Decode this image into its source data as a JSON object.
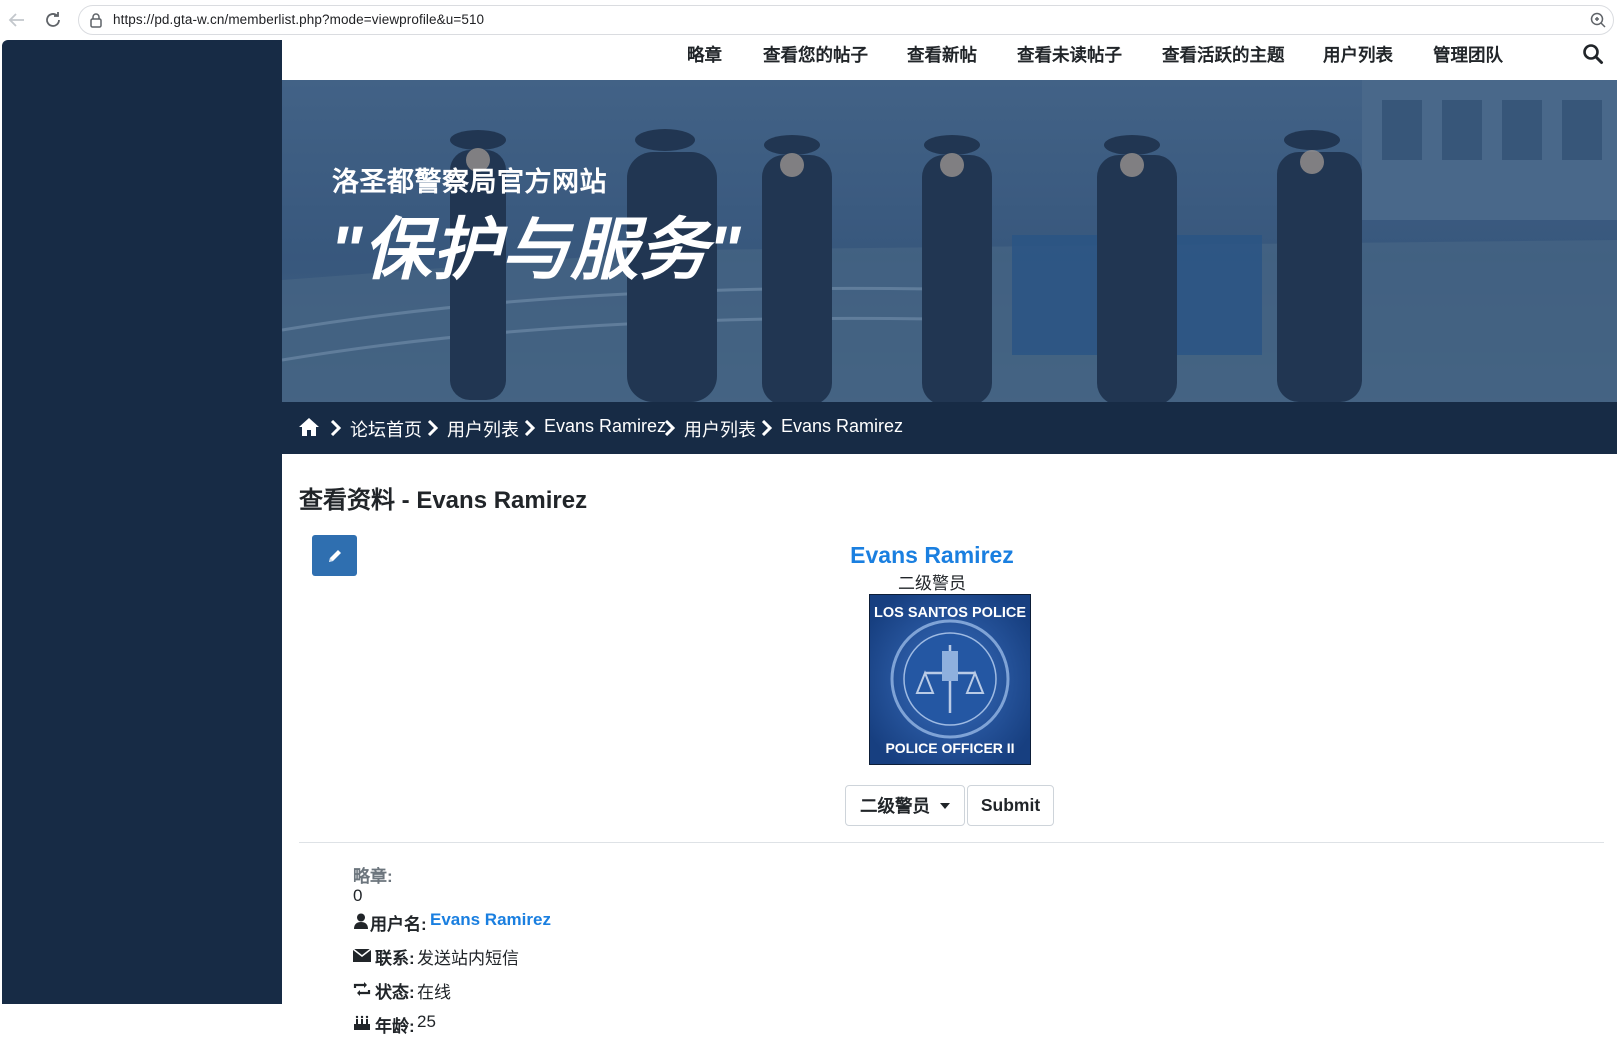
{
  "browser": {
    "url": "https://pd.gta-w.cn/memberlist.php?mode=viewprofile&u=510"
  },
  "topnav": {
    "items": [
      "略章",
      "查看您的帖子",
      "查看新帖",
      "查看未读帖子",
      "查看活跃的主题",
      "用户列表",
      "管理团队"
    ]
  },
  "banner": {
    "subtitle": "洛圣都警察局官方网站",
    "slogan": "\"保护与服务\""
  },
  "breadcrumb": {
    "items": [
      "论坛首页",
      "用户列表",
      "Evans Ramirez",
      "用户列表",
      "Evans Ramirez"
    ]
  },
  "page": {
    "title": "查看资料 - Evans Ramirez"
  },
  "profile": {
    "name": "Evans Ramirez",
    "rank": "二级警员",
    "badge_top": "LOS SANTOS POLICE",
    "badge_bottom": "POLICE OFFICER II",
    "rank_select": "二级警员",
    "submit_label": "Submit"
  },
  "details": {
    "medals_label": "略章:",
    "medals_value": "0",
    "username_label": "用户名:",
    "username_value": "Evans Ramirez",
    "contact_label": "联系:",
    "contact_value": "发送站内短信",
    "status_label": "状态:",
    "status_value": "在线",
    "age_label": "年龄:",
    "age_value": "25"
  },
  "colors": {
    "navy": "#172b45",
    "link_blue": "#1a7fe0",
    "button_blue": "#2f6fb0"
  }
}
